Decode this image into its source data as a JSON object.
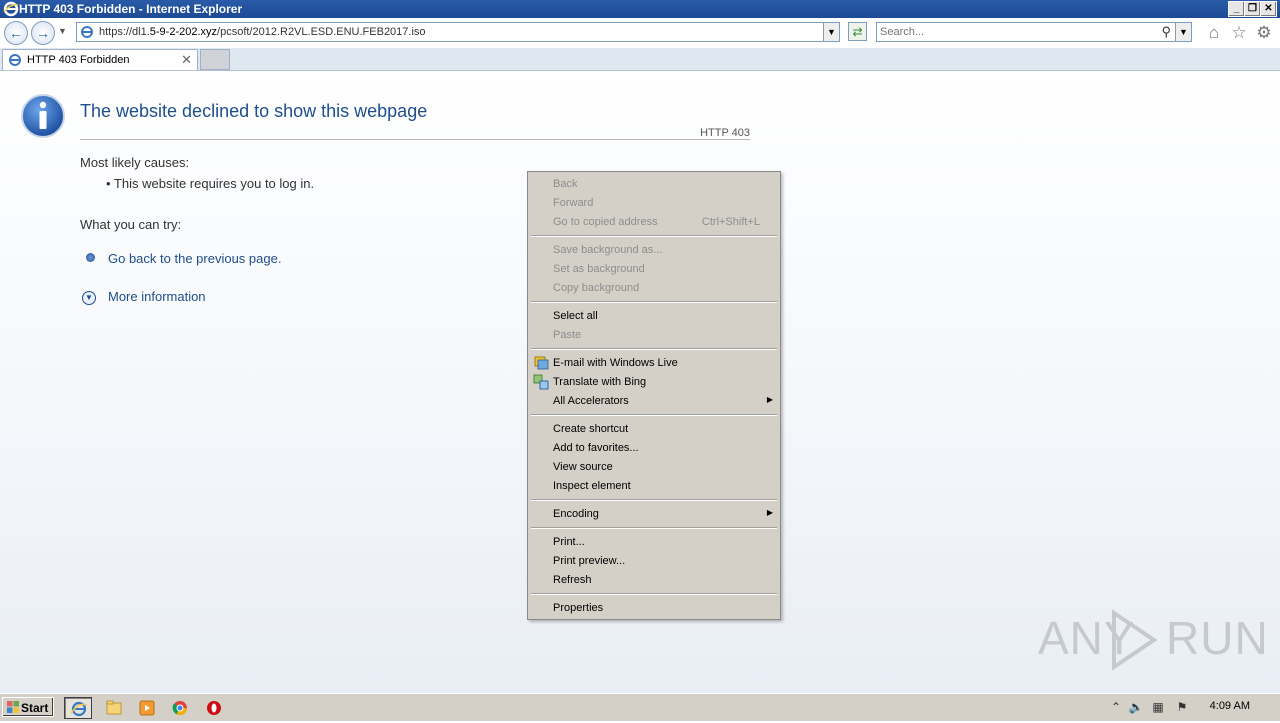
{
  "window": {
    "title": "HTTP 403 Forbidden - Internet Explorer",
    "controls": [
      "_",
      "❐",
      "✕"
    ]
  },
  "navbar": {
    "url_prefix": "https://dl1.",
    "url_domain": "5-9-2-202.xyz",
    "url_path": "/pcsoft/2012.R2VL.ESD.ENU.FEB2017.iso",
    "search_placeholder": "Search..."
  },
  "tab": {
    "label": "HTTP 403 Forbidden",
    "close": "✕"
  },
  "page": {
    "heading": "The website declined to show this webpage",
    "code": "HTTP 403",
    "causes_heading": "Most likely causes:",
    "cause_item": "•  This website requires you to log in.",
    "try_heading": "What you can try:",
    "link_back": "Go back to the previous page.",
    "link_more": "More information"
  },
  "context_menu": {
    "items": [
      {
        "label": "Back",
        "disabled": true
      },
      {
        "label": "Forward",
        "disabled": true
      },
      {
        "label": "Go to copied address",
        "shortcut": "Ctrl+Shift+L",
        "disabled": true
      },
      {
        "label": "Save background as...",
        "disabled": true
      },
      {
        "label": "Set as background",
        "disabled": true
      },
      {
        "label": "Copy background",
        "disabled": true
      },
      {
        "label": "Select all",
        "disabled": false
      },
      {
        "label": "Paste",
        "disabled": true
      },
      {
        "label": "E-mail with Windows Live",
        "disabled": false,
        "icon": "email-icon"
      },
      {
        "label": "Translate with Bing",
        "disabled": false,
        "icon": "translate-icon"
      },
      {
        "label": "All Accelerators",
        "disabled": false,
        "submenu": true
      },
      {
        "label": "Create shortcut",
        "disabled": false
      },
      {
        "label": "Add to favorites...",
        "disabled": false
      },
      {
        "label": "View source",
        "disabled": false
      },
      {
        "label": "Inspect element",
        "disabled": false
      },
      {
        "label": "Encoding",
        "disabled": false,
        "submenu": true
      },
      {
        "label": "Print...",
        "disabled": false
      },
      {
        "label": "Print preview...",
        "disabled": false
      },
      {
        "label": "Refresh",
        "disabled": false
      },
      {
        "label": "Properties",
        "disabled": false
      }
    ]
  },
  "watermark": {
    "left": "ANY",
    "right": "RUN"
  },
  "taskbar": {
    "start_label": "Start",
    "clock": "4:09 AM"
  },
  "colors": {
    "accent": "#1f4e8c",
    "menu_bg": "#d4d0c8",
    "disabled_text": "#8d8d8d"
  }
}
